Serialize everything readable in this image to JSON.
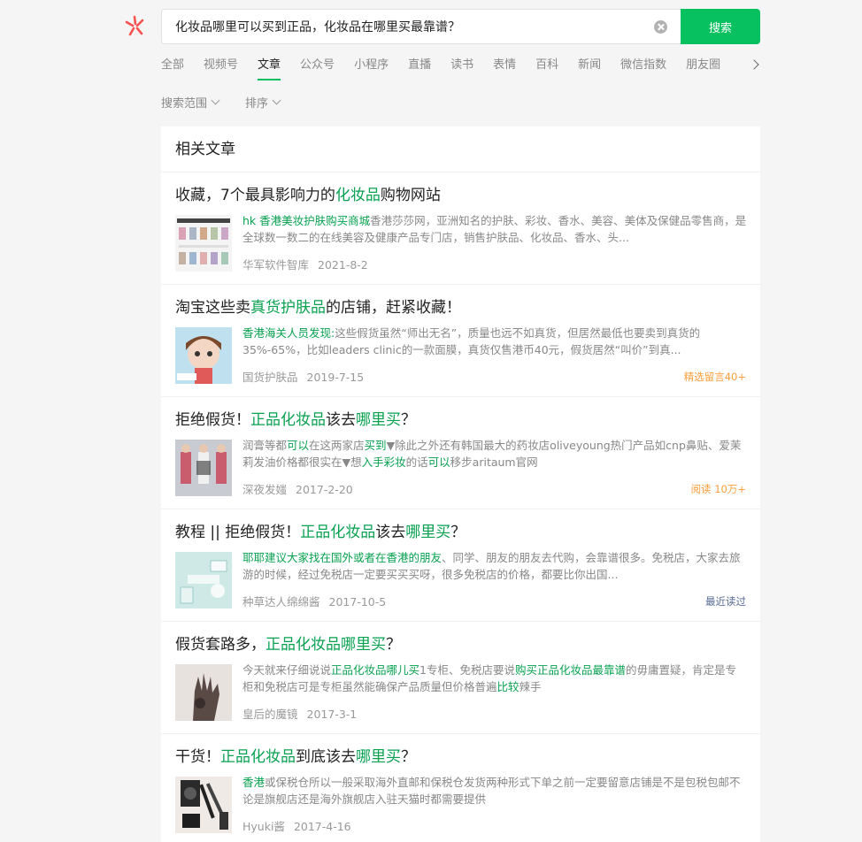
{
  "search": {
    "query": "化妆品哪里可以买到正品，化妆品在哪里买最靠谱？",
    "button_label": "搜索"
  },
  "tabs": [
    {
      "label": "全部",
      "active": false
    },
    {
      "label": "视频号",
      "active": false
    },
    {
      "label": "文章",
      "active": true
    },
    {
      "label": "公众号",
      "active": false
    },
    {
      "label": "小程序",
      "active": false
    },
    {
      "label": "直播",
      "active": false
    },
    {
      "label": "读书",
      "active": false
    },
    {
      "label": "表情",
      "active": false
    },
    {
      "label": "百科",
      "active": false
    },
    {
      "label": "新闻",
      "active": false
    },
    {
      "label": "微信指数",
      "active": false
    },
    {
      "label": "朋友圈",
      "active": false
    }
  ],
  "filters": {
    "scope_label": "搜索范围",
    "sort_label": "排序"
  },
  "section_title": "相关文章",
  "colors": {
    "accent": "#07c160",
    "highlight": "#07a150",
    "badge_orange": "#fa9d3b",
    "badge_blue": "#576b95"
  },
  "articles": [
    {
      "title_parts": [
        {
          "text": "收藏，7个最具影响力的",
          "hl": false
        },
        {
          "text": "化妆品",
          "hl": true
        },
        {
          "text": "购物网站",
          "hl": false
        }
      ],
      "snippet_parts": [
        {
          "text": "hk 香港美妆护肤购买商城",
          "hl": true
        },
        {
          "text": "香港莎莎网，亚洲知名的护肤、彩妆、香水、美容、美体及保健品零售商，是全球数一数二的在线美容及健康产品专门店，销售护肤品、化妆品、香水、头...",
          "hl": false
        }
      ],
      "source": "华军软件智库",
      "date": "2021-8-2",
      "badge": null,
      "badge_color": null,
      "thumb": "webpage-screenshot-thumb"
    },
    {
      "title_parts": [
        {
          "text": "淘宝这些卖",
          "hl": false
        },
        {
          "text": "真货护肤品",
          "hl": true
        },
        {
          "text": "的店铺，赶紧收藏！",
          "hl": false
        }
      ],
      "snippet_parts": [
        {
          "text": "香港海关人员发现:",
          "hl": true
        },
        {
          "text": "这些假货虽然“师出无名”，质量也远不如真货，但居然最低也要卖到真货的35%-65%，比如leaders clinic的一款面膜，真货仅售港币40元，假货居然“叫价”到真...",
          "hl": false
        }
      ],
      "source": "国货护肤品",
      "date": "2019-7-15",
      "badge": "精选留言40+",
      "badge_color": "orange",
      "thumb": "cartoon-girl-thumb"
    },
    {
      "title_parts": [
        {
          "text": "拒绝假货！",
          "hl": false
        },
        {
          "text": "正品化妆品",
          "hl": true
        },
        {
          "text": "该去",
          "hl": false
        },
        {
          "text": "哪里买",
          "hl": true
        },
        {
          "text": "？",
          "hl": false
        }
      ],
      "snippet_parts": [
        {
          "text": "润膏等都",
          "hl": false
        },
        {
          "text": "可以",
          "hl": true
        },
        {
          "text": "在这两家店",
          "hl": false
        },
        {
          "text": "买到",
          "hl": true
        },
        {
          "text": "▼除此之外还有韩国最大的药妆店oliveyoung热门产品如cnp鼻贴、爱茉莉发油价格都很实在▼想",
          "hl": false
        },
        {
          "text": "入手彩妆",
          "hl": true
        },
        {
          "text": "的话",
          "hl": false
        },
        {
          "text": "可以",
          "hl": true
        },
        {
          "text": "移步aritaum官网",
          "hl": false
        }
      ],
      "source": "深夜发媸",
      "date": "2017-2-20",
      "badge": "阅读 10万+",
      "badge_color": "orange",
      "thumb": "models-poster-thumb"
    },
    {
      "title_parts": [
        {
          "text": "教程 || 拒绝假货！",
          "hl": false
        },
        {
          "text": "正品化妆品",
          "hl": true
        },
        {
          "text": "该去",
          "hl": false
        },
        {
          "text": "哪里买",
          "hl": true
        },
        {
          "text": "？",
          "hl": false
        }
      ],
      "snippet_parts": [
        {
          "text": "耶耶建议大家找在国外或者在香港的朋友",
          "hl": true
        },
        {
          "text": "、同学、朋友的朋友去代购，会靠谱很多。免税店，大家去旅游的时候，经过免税店一定要买买买呀，很多免税店的价格，都要比你出国...",
          "hl": false
        }
      ],
      "source": "种草达人绵绵酱",
      "date": "2017-10-5",
      "badge": "最近读过",
      "badge_color": "blue",
      "thumb": "cosmetics-teal-thumb"
    },
    {
      "title_parts": [
        {
          "text": "假货套路多，",
          "hl": false
        },
        {
          "text": "正品化妆品哪里买",
          "hl": true
        },
        {
          "text": "？",
          "hl": false
        }
      ],
      "snippet_parts": [
        {
          "text": "今天就来仔细说说",
          "hl": false
        },
        {
          "text": "正品化妆品哪儿买",
          "hl": true
        },
        {
          "text": "1专柜、免税店要说",
          "hl": false
        },
        {
          "text": "购买正品化妆品最靠谱",
          "hl": true
        },
        {
          "text": "的毋庸置疑，肯定是专柜和免税店可是专柜虽然能确保产品质量但价格普遍",
          "hl": false
        },
        {
          "text": "比较",
          "hl": true
        },
        {
          "text": "辣手",
          "hl": false
        }
      ],
      "source": "皇后的魔镜",
      "date": "2017-3-1",
      "badge": null,
      "badge_color": null,
      "thumb": "hand-thumb"
    },
    {
      "title_parts": [
        {
          "text": "干货！",
          "hl": false
        },
        {
          "text": "正品化妆品",
          "hl": true
        },
        {
          "text": "到底该去",
          "hl": false
        },
        {
          "text": "哪里买",
          "hl": true
        },
        {
          "text": "？",
          "hl": false
        }
      ],
      "snippet_parts": [
        {
          "text": "香港",
          "hl": true
        },
        {
          "text": "或保税仓所以一般采取海外直邮和保税仓发货两种形式下单之前一定要留意店铺是不是包税包邮不论是旗舰店还是海外旗舰店入驻天猫时都需要提供",
          "hl": false
        }
      ],
      "source": "Hyuki酱",
      "date": "2017-4-16",
      "badge": null,
      "badge_color": null,
      "thumb": "makeup-brushes-thumb"
    }
  ]
}
